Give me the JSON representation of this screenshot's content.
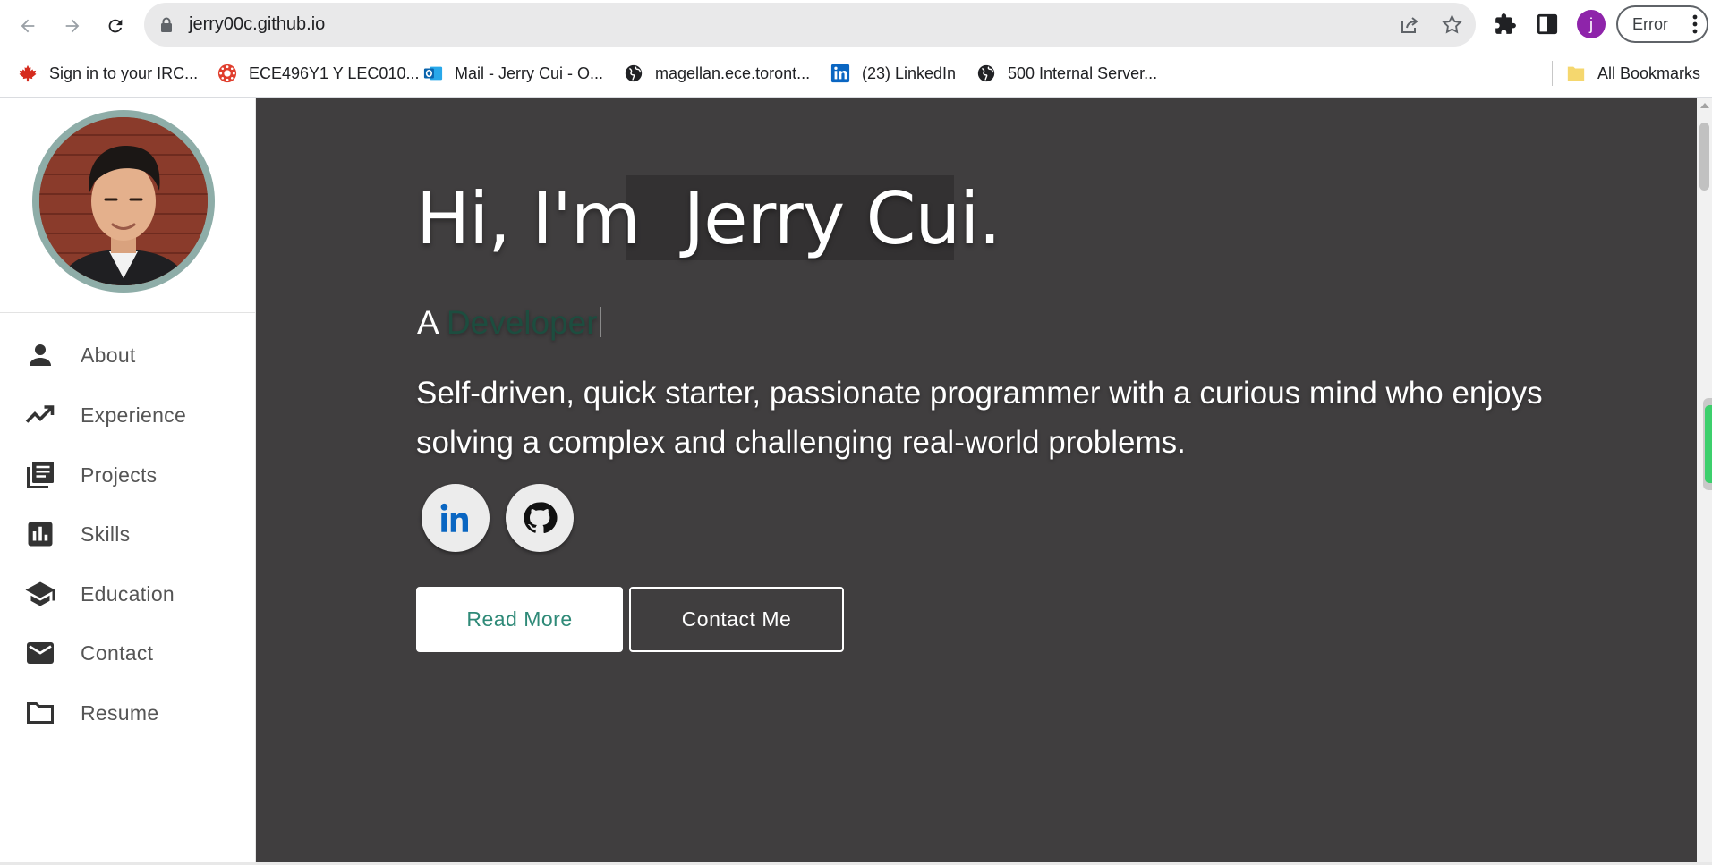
{
  "browser": {
    "url": "jerry00c.github.io",
    "profile_initial": "j",
    "error_label": "Error",
    "bookmarks": [
      {
        "label": "Sign in to your IRC..."
      },
      {
        "label": "ECE496Y1 Y LEC010..."
      },
      {
        "label": "Mail - Jerry Cui - O..."
      },
      {
        "label": "magellan.ece.toront..."
      },
      {
        "label": "(23) LinkedIn"
      },
      {
        "label": "500 Internal Server..."
      }
    ],
    "all_bookmarks_label": "All Bookmarks"
  },
  "sidebar": {
    "items": [
      {
        "label": "About",
        "icon": "person-icon"
      },
      {
        "label": "Experience",
        "icon": "trending-up-icon"
      },
      {
        "label": "Projects",
        "icon": "library-books-icon"
      },
      {
        "label": "Skills",
        "icon": "bar-chart-icon"
      },
      {
        "label": "Education",
        "icon": "school-icon"
      },
      {
        "label": "Contact",
        "icon": "mail-icon"
      },
      {
        "label": "Resume",
        "icon": "folder-icon"
      }
    ]
  },
  "hero": {
    "greeting": "Hi, I'm ",
    "name": "Jerry Cui.",
    "subtitle_prefix": "A ",
    "subtitle_role": "Developer",
    "tagline": "Self-driven, quick starter, passionate programmer with a curious mind who enjoys solving a complex and challenging real-world problems.",
    "read_more_label": "Read More",
    "contact_label": "Contact Me",
    "accent_color": "#2f8a78",
    "background_color": "#403e3f"
  }
}
